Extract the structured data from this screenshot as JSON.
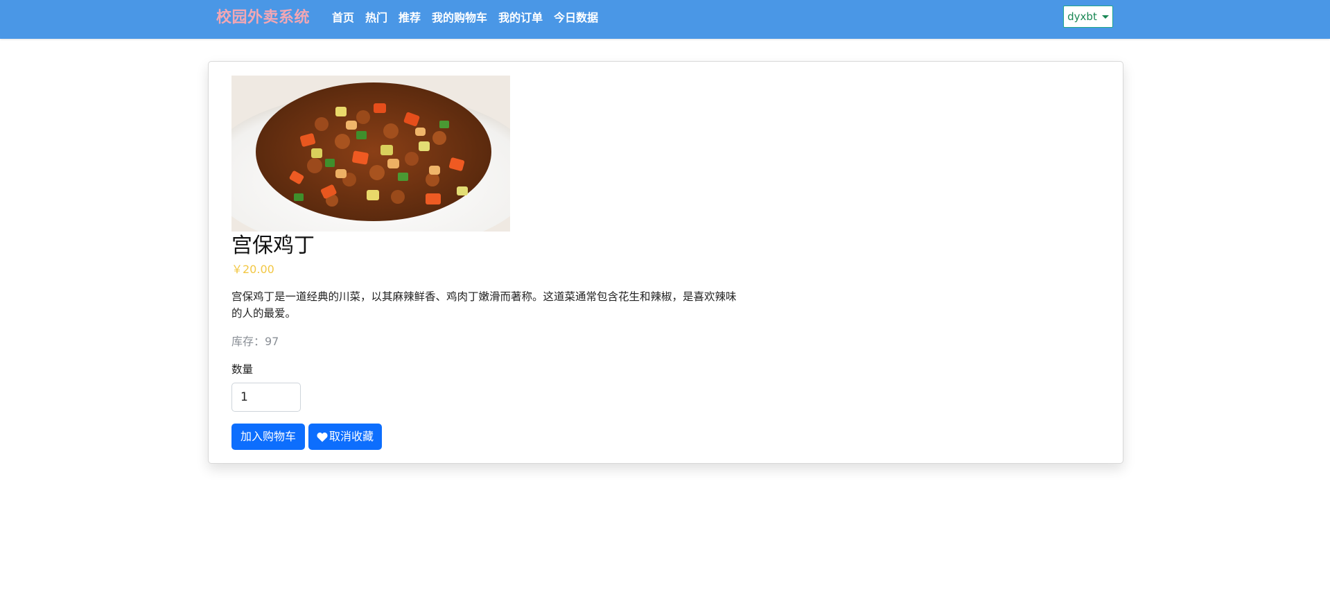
{
  "navbar": {
    "brand": "校园外卖系统",
    "links": [
      "首页",
      "热门",
      "推荐",
      "我的购物车",
      "我的订单",
      "今日数据"
    ],
    "user": "dyxbt"
  },
  "dish": {
    "image_icon": "dish-photo",
    "title": "宫保鸡丁",
    "price": "￥20.00",
    "description": "宫保鸡丁是一道经典的川菜，以其麻辣鲜香、鸡肉丁嫩滑而著称。这道菜通常包含花生和辣椒，是喜欢辣味的人的最爱。",
    "stock": "库存：97",
    "quantity_label": "数量",
    "quantity_value": "1",
    "add_to_cart_label": "加入购物车",
    "unfavorite_label": "取消收藏",
    "unfavorite_icon": "heart-icon"
  },
  "colors": {
    "navbar_bg": "#4a97e6",
    "brand": "#f2a7b4",
    "price": "#f2c744",
    "primary_button": "#0d6efd",
    "user_button": "#198754"
  }
}
